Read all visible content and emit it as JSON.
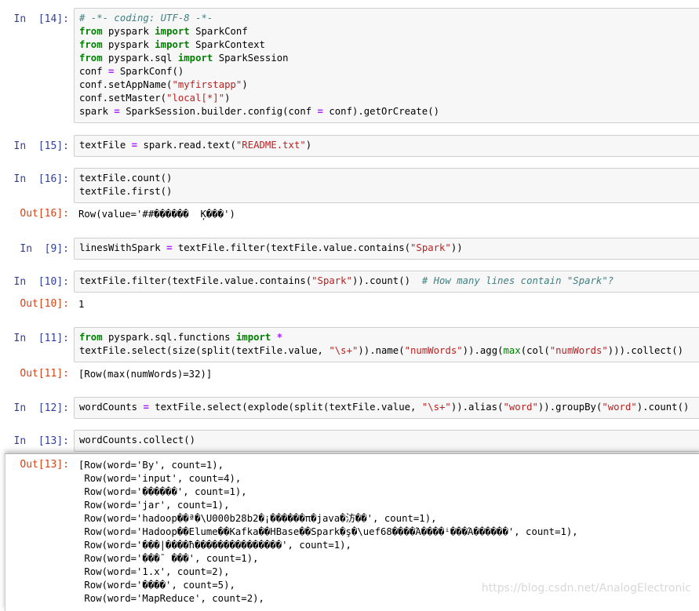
{
  "cells": [
    {
      "id": "14",
      "prompt": "In  [14]:",
      "lines": [
        [
          [
            "c",
            "# -*- coding: UTF-8 -*-"
          ]
        ],
        [
          [
            "k",
            "from"
          ],
          [
            "t",
            " pyspark "
          ],
          [
            "k",
            "import"
          ],
          [
            "t",
            " SparkConf"
          ]
        ],
        [
          [
            "k",
            "from"
          ],
          [
            "t",
            " pyspark "
          ],
          [
            "k",
            "import"
          ],
          [
            "t",
            " SparkContext"
          ]
        ],
        [
          [
            "k",
            "from"
          ],
          [
            "t",
            " pyspark.sql "
          ],
          [
            "k",
            "import"
          ],
          [
            "t",
            " SparkSession"
          ]
        ],
        [
          [
            "t",
            "conf "
          ],
          [
            "o",
            "="
          ],
          [
            "t",
            " SparkConf()"
          ]
        ],
        [
          [
            "t",
            "conf.setAppName("
          ],
          [
            "s",
            "\"myfirstapp\""
          ],
          [
            "t",
            ")"
          ]
        ],
        [
          [
            "t",
            "conf.setMaster("
          ],
          [
            "s",
            "\"local[*]\""
          ],
          [
            "t",
            ")"
          ]
        ],
        [
          [
            "t",
            "spark "
          ],
          [
            "o",
            "="
          ],
          [
            "t",
            " SparkSession.builder.config(conf "
          ],
          [
            "o",
            "="
          ],
          [
            "t",
            " conf).getOrCreate()"
          ]
        ]
      ]
    },
    {
      "id": "15",
      "prompt": "In  [15]:",
      "lines": [
        [
          [
            "t",
            "textFile "
          ],
          [
            "o",
            "="
          ],
          [
            "t",
            " spark.read.text("
          ],
          [
            "s",
            "\"README.txt\""
          ],
          [
            "t",
            ")"
          ]
        ]
      ]
    },
    {
      "id": "16",
      "prompt": "In  [16]:",
      "lines": [
        [
          [
            "t",
            "textFile.count()"
          ]
        ],
        [
          [
            "t",
            "textFile.first()"
          ]
        ]
      ],
      "out_prompt": "Out[16]:",
      "out_lines": [
        "Row(value='##������  Ķ���')"
      ]
    },
    {
      "id": "9",
      "prompt": "In  [9]:",
      "lines": [
        [
          [
            "t",
            "linesWithSpark "
          ],
          [
            "o",
            "="
          ],
          [
            "t",
            " textFile.filter(textFile.value.contains("
          ],
          [
            "s",
            "\"Spark\""
          ],
          [
            "t",
            "))"
          ]
        ]
      ]
    },
    {
      "id": "10",
      "prompt": "In  [10]:",
      "lines": [
        [
          [
            "t",
            "textFile.filter(textFile.value.contains("
          ],
          [
            "s",
            "\"Spark\""
          ],
          [
            "t",
            ")).count()  "
          ],
          [
            "c",
            "# How many lines contain \"Spark\"?"
          ]
        ]
      ],
      "out_prompt": "Out[10]:",
      "out_lines": [
        "1"
      ]
    },
    {
      "id": "11",
      "prompt": "In  [11]:",
      "lines": [
        [
          [
            "k",
            "from"
          ],
          [
            "t",
            " pyspark.sql.functions "
          ],
          [
            "k",
            "import"
          ],
          [
            "t",
            " "
          ],
          [
            "o",
            "*"
          ]
        ],
        [
          [
            "t",
            "textFile.select(size(split(textFile.value, "
          ],
          [
            "s",
            "\"\\s+\""
          ],
          [
            "t",
            ")).name("
          ],
          [
            "s",
            "\"numWords\""
          ],
          [
            "t",
            ")).agg("
          ],
          [
            "b",
            "max"
          ],
          [
            "t",
            "(col("
          ],
          [
            "s",
            "\"numWords\""
          ],
          [
            "t",
            "))).collect()"
          ]
        ]
      ],
      "out_prompt": "Out[11]:",
      "out_lines": [
        "[Row(max(numWords)=32)]"
      ]
    },
    {
      "id": "12",
      "prompt": "In  [12]:",
      "lines": [
        [
          [
            "t",
            "wordCounts "
          ],
          [
            "o",
            "="
          ],
          [
            "t",
            " textFile.select(explode(split(textFile.value, "
          ],
          [
            "s",
            "\"\\s+\""
          ],
          [
            "t",
            ")).alias("
          ],
          [
            "s",
            "\"word\""
          ],
          [
            "t",
            ")).groupBy("
          ],
          [
            "s",
            "\"word\""
          ],
          [
            "t",
            ").count()"
          ]
        ]
      ]
    },
    {
      "id": "13",
      "prompt": "In  [13]:",
      "lines": [
        [
          [
            "t",
            "wordCounts.collect()"
          ]
        ]
      ],
      "out_prompt": "Out[13]:",
      "out_lines": [
        "[Row(word='By', count=1),",
        " Row(word='input', count=4),",
        " Row(word='������', count=1),",
        " Row(word='jar', count=1),",
        " Row(word='hadoop��ª�\\U000b28b2�¡������π�java�汸��', count=1),",
        " Row(word='Hadoop��Elume��Kafka��HBase��Spark�ş�\\uef68����Ά����ⁱ���Ά������', count=1),",
        " Row(word='���|����ħ���������������', count=1),",
        " Row(word='���¯ ���', count=1),",
        " Row(word='1.x', count=2),",
        " Row(word='����', count=5),",
        " Row(word='MapReduce', count=2),"
      ]
    }
  ],
  "watermark": "https://blog.csdn.net/AnalogElectronic"
}
